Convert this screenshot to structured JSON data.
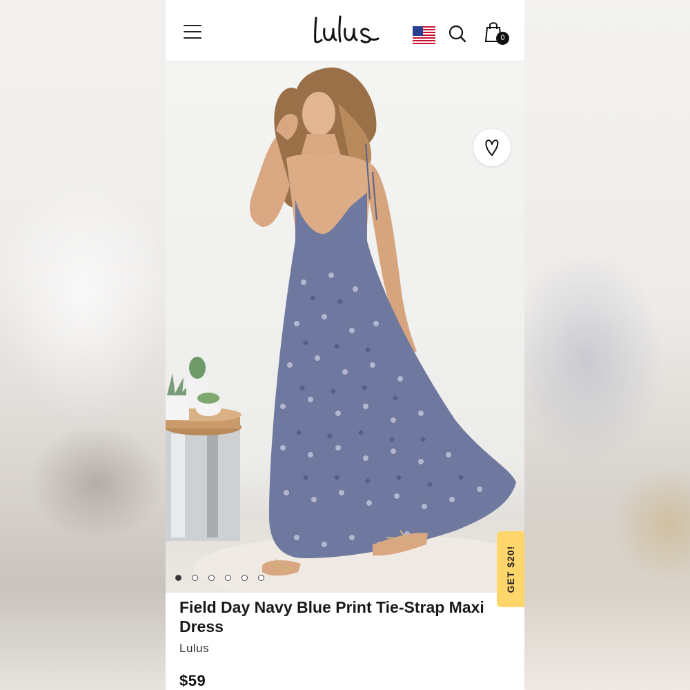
{
  "header": {
    "logo_text": "Lulus",
    "cart_count": "0"
  },
  "product": {
    "title": "Field Day Navy Blue Print Tie-Strap Maxi Dress",
    "brand": "Lulus",
    "price": "$59"
  },
  "promo": {
    "label": "GET $20!"
  },
  "carousel": {
    "total": 6,
    "active": 1
  },
  "icons": {
    "menu": "menu-icon",
    "flag": "us-flag-icon",
    "search": "search-icon",
    "bag": "shopping-bag-icon",
    "wishlist": "heart-icon"
  },
  "colors": {
    "promo_bg": "#ffd66b",
    "text": "#1a1a1a",
    "dress": "#6f789e"
  }
}
